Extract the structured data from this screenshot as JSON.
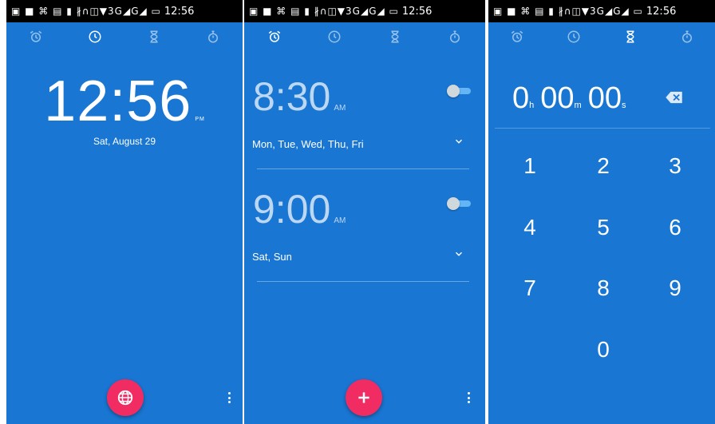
{
  "status_bar": {
    "icons_text": "▣ ■ ⌘ ▤ ▮  ∦∩◫▼3G◢G◢  ▭",
    "time": "12:56"
  },
  "tabs": [
    "alarm",
    "clock",
    "timer",
    "stopwatch"
  ],
  "clock": {
    "time": "12:56",
    "ampm": "PM",
    "date": "Sat, August 29",
    "fab_icon": "globe-icon"
  },
  "alarms": [
    {
      "time": "8:30",
      "ampm": "AM",
      "days": "Mon, Tue, Wed, Thu, Fri",
      "enabled": false
    },
    {
      "time": "9:00",
      "ampm": "AM",
      "days": "Sat, Sun",
      "enabled": false
    }
  ],
  "alarm_fab_icon": "add-icon",
  "timer": {
    "hours": "0",
    "h_unit": "h",
    "minutes": "00",
    "m_unit": "m",
    "seconds": "00",
    "s_unit": "s",
    "keys": [
      "1",
      "2",
      "3",
      "4",
      "5",
      "6",
      "7",
      "8",
      "9",
      "0"
    ]
  },
  "colors": {
    "background": "#1976d2",
    "fab": "#f02c62"
  }
}
